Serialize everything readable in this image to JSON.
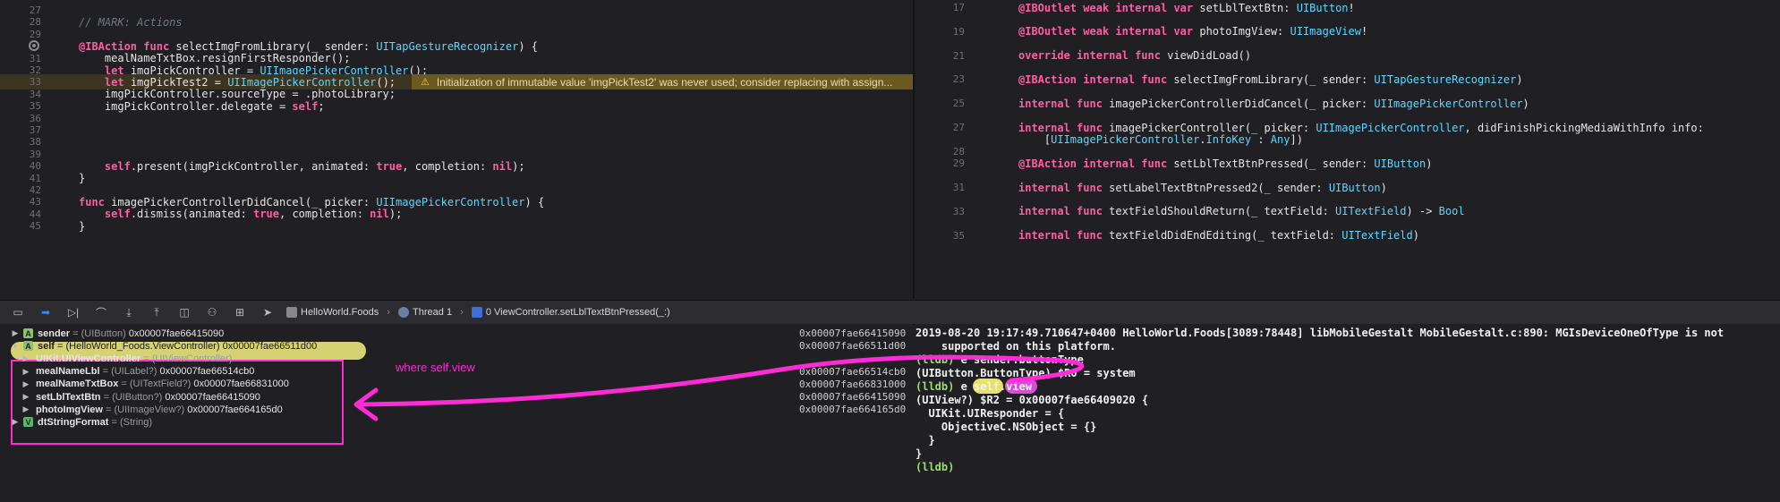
{
  "editor_left": {
    "lines": [
      {
        "n": "27",
        "code": ""
      },
      {
        "n": "28",
        "code": "// MARK: Actions",
        "type": "comment"
      },
      {
        "n": "29",
        "code": ""
      },
      {
        "n": "",
        "code": "@IBAction func selectImgFromLibrary(_ sender: UITapGestureRecognizer) {",
        "type": "decl",
        "breakpoint": true
      },
      {
        "n": "31",
        "code": "    mealNameTxtBox.resignFirstResponder();"
      },
      {
        "n": "32",
        "code": "    let imgPickController = UIImagePickerController();"
      },
      {
        "n": "33",
        "code": "    let imgPickTest2 = UIImagePickerController();",
        "warn": true
      },
      {
        "n": "34",
        "code": "    imgPickController.sourceType = .photoLibrary;"
      },
      {
        "n": "35",
        "code": "    imgPickController.delegate = self;"
      },
      {
        "n": "36",
        "code": ""
      },
      {
        "n": "37",
        "code": ""
      },
      {
        "n": "38",
        "code": ""
      },
      {
        "n": "39",
        "code": ""
      },
      {
        "n": "40",
        "code": "    self.present(imgPickController, animated: true, completion: nil);"
      },
      {
        "n": "41",
        "code": "}"
      },
      {
        "n": "42",
        "code": ""
      },
      {
        "n": "43",
        "code": "func imagePickerControllerDidCancel(_ picker: UIImagePickerController) {"
      },
      {
        "n": "44",
        "code": "    self.dismiss(animated: true, completion: nil);"
      },
      {
        "n": "45",
        "code": "}"
      }
    ],
    "warning": "Initialization of immutable value 'imgPickTest2' was never used; consider replacing with assign..."
  },
  "editor_right": {
    "lines": [
      {
        "n": "17",
        "code": "@IBOutlet weak internal var setLblTextBtn: UIButton!"
      },
      {
        "n": "",
        "code": ""
      },
      {
        "n": "19",
        "code": "@IBOutlet weak internal var photoImgView: UIImageView!"
      },
      {
        "n": "",
        "code": ""
      },
      {
        "n": "21",
        "code": "override internal func viewDidLoad()"
      },
      {
        "n": "",
        "code": ""
      },
      {
        "n": "23",
        "code": "@IBAction internal func selectImgFromLibrary(_ sender: UITapGestureRecognizer)"
      },
      {
        "n": "",
        "code": ""
      },
      {
        "n": "25",
        "code": "internal func imagePickerControllerDidCancel(_ picker: UIImagePickerController)"
      },
      {
        "n": "",
        "code": ""
      },
      {
        "n": "27",
        "code": "internal func imagePickerController(_ picker: UIImagePickerController, didFinishPickingMediaWithInfo info:"
      },
      {
        "n": "",
        "code": "    [UIImagePickerController.InfoKey : Any])"
      },
      {
        "n": "28",
        "code": ""
      },
      {
        "n": "29",
        "code": "@IBAction internal func setLblTextBtnPressed(_ sender: UIButton)"
      },
      {
        "n": "",
        "code": ""
      },
      {
        "n": "31",
        "code": "internal func setLabelTextBtnPressed2(_ sender: UIButton)"
      },
      {
        "n": "",
        "code": ""
      },
      {
        "n": "33",
        "code": "internal func textFieldShouldReturn(_ textField: UITextField) -> Bool"
      },
      {
        "n": "",
        "code": ""
      },
      {
        "n": "35",
        "code": "internal func textFieldDidEndEditing(_ textField: UITextField)"
      }
    ]
  },
  "debug_bar": {
    "crumb_app": "HelloWorld.Foods",
    "crumb_thread": "Thread 1",
    "crumb_frame": "0 ViewController.setLblTextBtnPressed(_:)"
  },
  "variables": [
    {
      "indent": 0,
      "tri": "▶",
      "tag": "A",
      "name": "sender",
      "type": "(UIButton)",
      "value": "0x00007fae66415090",
      "addr": "0x00007fae66415090"
    },
    {
      "indent": 0,
      "tri": "▼",
      "tag": "A",
      "name": "self",
      "type": "(HelloWorld_Foods.ViewController)",
      "value": "0x00007fae66511d00",
      "addr": "0x00007fae66511d00",
      "highlight": true
    },
    {
      "indent": 1,
      "tri": "▶",
      "tag": "",
      "name": "UIKit.UIViewController",
      "type": "(UIViewController)",
      "value": "",
      "addr": ""
    },
    {
      "indent": 1,
      "tri": "▶",
      "tag": "",
      "name": "mealNameLbl",
      "type": "(UILabel?)",
      "value": "0x00007fae66514cb0",
      "addr": "0x00007fae66514cb0"
    },
    {
      "indent": 1,
      "tri": "▶",
      "tag": "",
      "name": "mealNameTxtBox",
      "type": "(UITextField?)",
      "value": "0x00007fae66831000",
      "addr": "0x00007fae66831000"
    },
    {
      "indent": 1,
      "tri": "▶",
      "tag": "",
      "name": "setLblTextBtn",
      "type": "(UIButton?)",
      "value": "0x00007fae66415090",
      "addr": "0x00007fae66415090"
    },
    {
      "indent": 1,
      "tri": "▶",
      "tag": "",
      "name": "photoImgView",
      "type": "(UIImageView?)",
      "value": "0x00007fae664165d0",
      "addr": "0x00007fae664165d0"
    },
    {
      "indent": 0,
      "tri": "▶",
      "tag": "V",
      "name": "dtStringFormat",
      "type": "(String)",
      "value": "",
      "addr": ""
    }
  ],
  "annotation_text": "where self.view",
  "console": [
    {
      "text": "2019-08-20 19:17:49.710647+0400 HelloWorld.Foods[3089:78448] libMobileGestalt MobileGestalt.c:890: MGIsDeviceOneOfType is not"
    },
    {
      "text": "    supported on this platform."
    },
    {
      "text": "(lldb) e sender.buttonType"
    },
    {
      "text": "(UIButton.ButtonType) $R0 = system"
    },
    {
      "text": "(lldb) e self.view"
    },
    {
      "text": "(UIView?) $R2 = 0x00007fae66409020 {"
    },
    {
      "text": "  UIKit.UIResponder = {"
    },
    {
      "text": "    ObjectiveC.NSObject = {}"
    },
    {
      "text": "  }"
    },
    {
      "text": "}"
    },
    {
      "text": "(lldb)"
    }
  ],
  "colors": {
    "annotation": "#ff2bd6",
    "highlight_yellow": "#e6e27b",
    "warning_bar": "#6b5a20"
  }
}
